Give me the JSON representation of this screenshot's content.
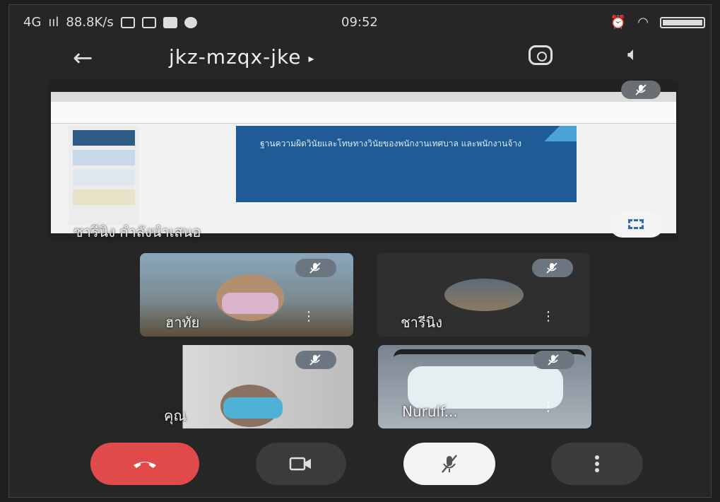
{
  "status_bar": {
    "network": "4G",
    "signal": "ııl",
    "speed": "88.8K/s",
    "time": "09:52"
  },
  "header": {
    "meeting_code": "jkz-mzqx-jke",
    "title_caret": "▸"
  },
  "presentation": {
    "presenter_label": "ชารีนิง กำลังนำเสนอ",
    "slide_text": "ฐานความผิดวินัยและโทษทางวินัยของพนักงานเทศบาล และพนักงานจ้าง"
  },
  "participants": [
    {
      "name": "ฮาทัย"
    },
    {
      "name": "ชารีนิง"
    },
    {
      "name": "คุณ"
    },
    {
      "name": "Nurulf..."
    }
  ],
  "colors": {
    "hangup": "#e04a4a",
    "background": "#262626",
    "slide_blue": "#1f5b94"
  },
  "icons": {
    "back": "arrow-left-icon",
    "switch_camera": "switch-camera-icon",
    "speaker": "speaker-icon",
    "mic_off": "mic-off-icon",
    "fullscreen": "fullscreen-icon",
    "more": "more-vertical-icon",
    "hangup": "phone-hangup-icon",
    "camera": "video-camera-icon"
  }
}
